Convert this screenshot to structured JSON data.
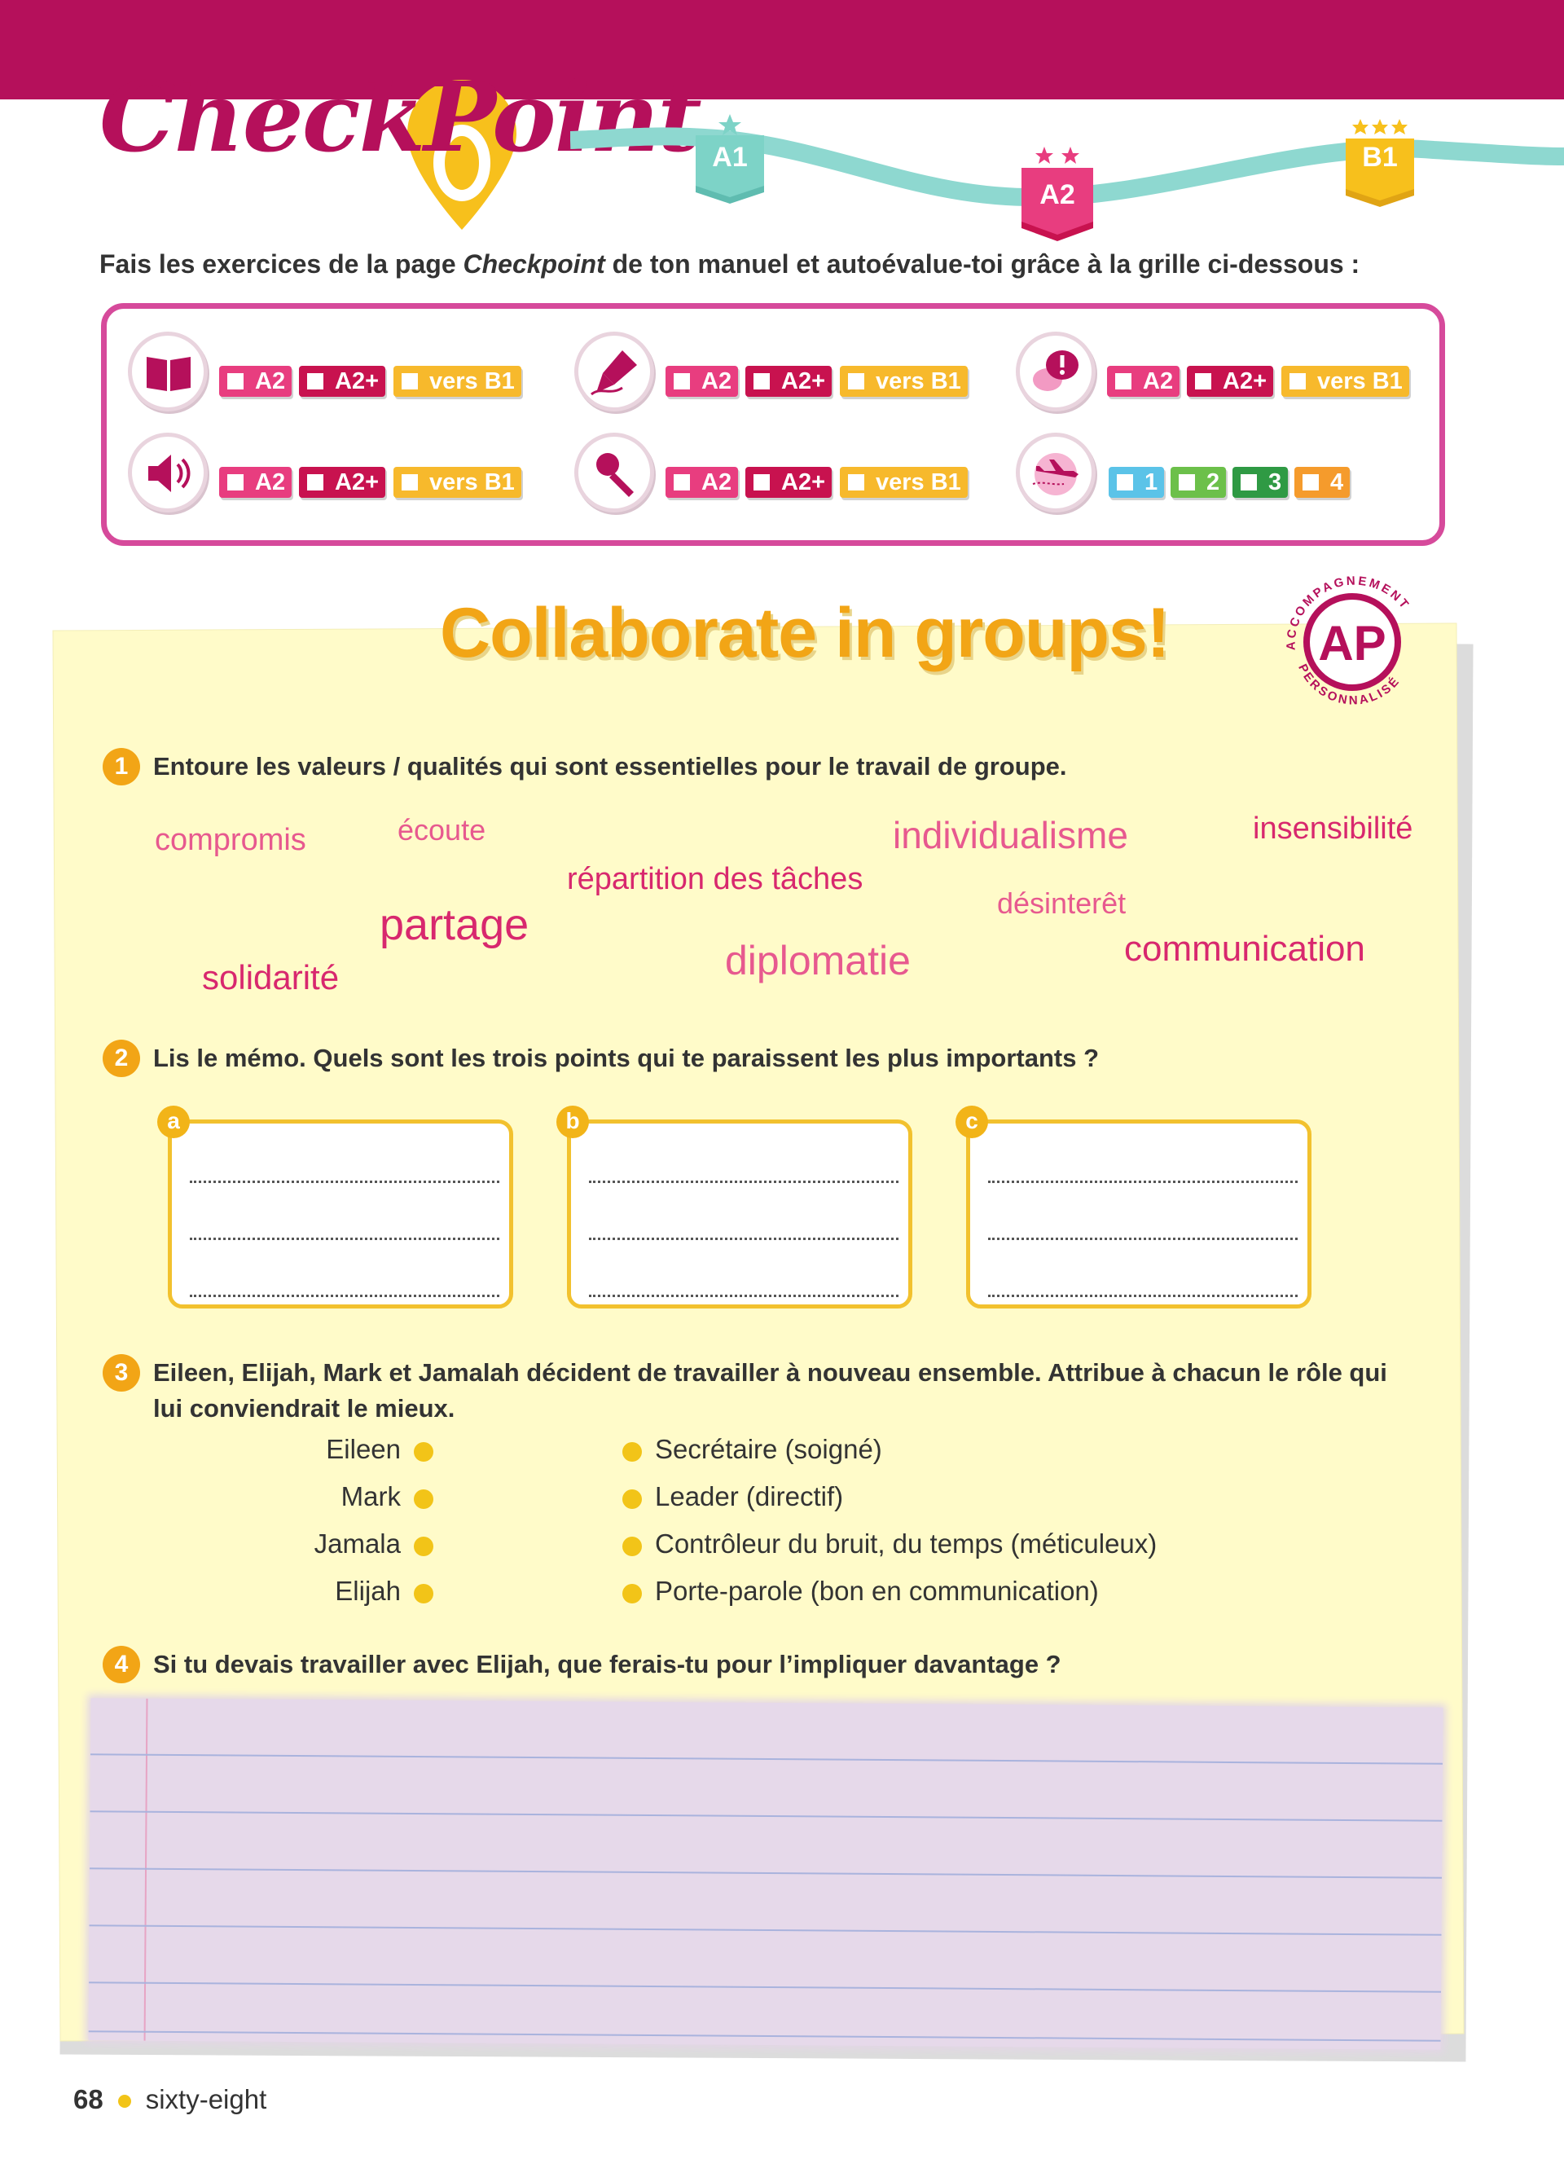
{
  "header": {
    "logo_text": "CheckPoint",
    "levels": [
      "A1",
      "A2",
      "B1"
    ]
  },
  "intro": {
    "before": "Fais les exercices de la page ",
    "emph": "Checkpoint",
    "after": " de ton manuel et autoévalue-toi grâce à la grille ci-dessous :"
  },
  "grid": {
    "level_tags": [
      "A2",
      "A2+",
      "vers B1"
    ],
    "number_tags": [
      "1",
      "2",
      "3",
      "4"
    ],
    "icons": [
      "book-icon",
      "pen-nib-icon",
      "speech-bubble-icon",
      "speaker-icon",
      "microphone-icon",
      "plane-icon"
    ]
  },
  "worksheet": {
    "title": "Collaborate in groups!",
    "seal": {
      "center": "AP",
      "top": "ACCOMPAGNEMENT",
      "bottom": "PERSONNALISÉ"
    }
  },
  "q1": {
    "num": "1",
    "text": "Entoure les valeurs / qualités qui sont essentielles pour le travail de groupe.",
    "words": [
      "compromis",
      "écoute",
      "individualisme",
      "insensibilité",
      "répartition des tâches",
      "désinterêt",
      "partage",
      "diplomatie",
      "communication",
      "solidarité"
    ]
  },
  "q2": {
    "num": "2",
    "text": "Lis le mémo. Quels sont les trois points qui te paraissent les plus importants ?",
    "boxes": [
      "a",
      "b",
      "c"
    ]
  },
  "q3": {
    "num": "3",
    "text_line1": "Eileen, Elijah, Mark et Jamalah décident de travailler à nouveau ensemble. Attribue à chacun le rôle qui",
    "text_line2": "lui conviendrait le mieux.",
    "names": [
      "Eileen",
      "Mark",
      "Jamala",
      "Elijah"
    ],
    "roles": [
      "Secrétaire (soigné)",
      "Leader (directif)",
      "Contrôleur du bruit, du temps (méticuleux)",
      "Porte-parole (bon en communication)"
    ]
  },
  "q4": {
    "num": "4",
    "text": "Si tu devais travailler avec Elijah, que ferais-tu pour l’impliquer davantage ?"
  },
  "footer": {
    "page_number": "68",
    "page_words": "sixty-eight"
  },
  "colors": {
    "brand": "#b5105b",
    "accent_yellow": "#f2a516",
    "teal_path": "#8ed8d0"
  }
}
